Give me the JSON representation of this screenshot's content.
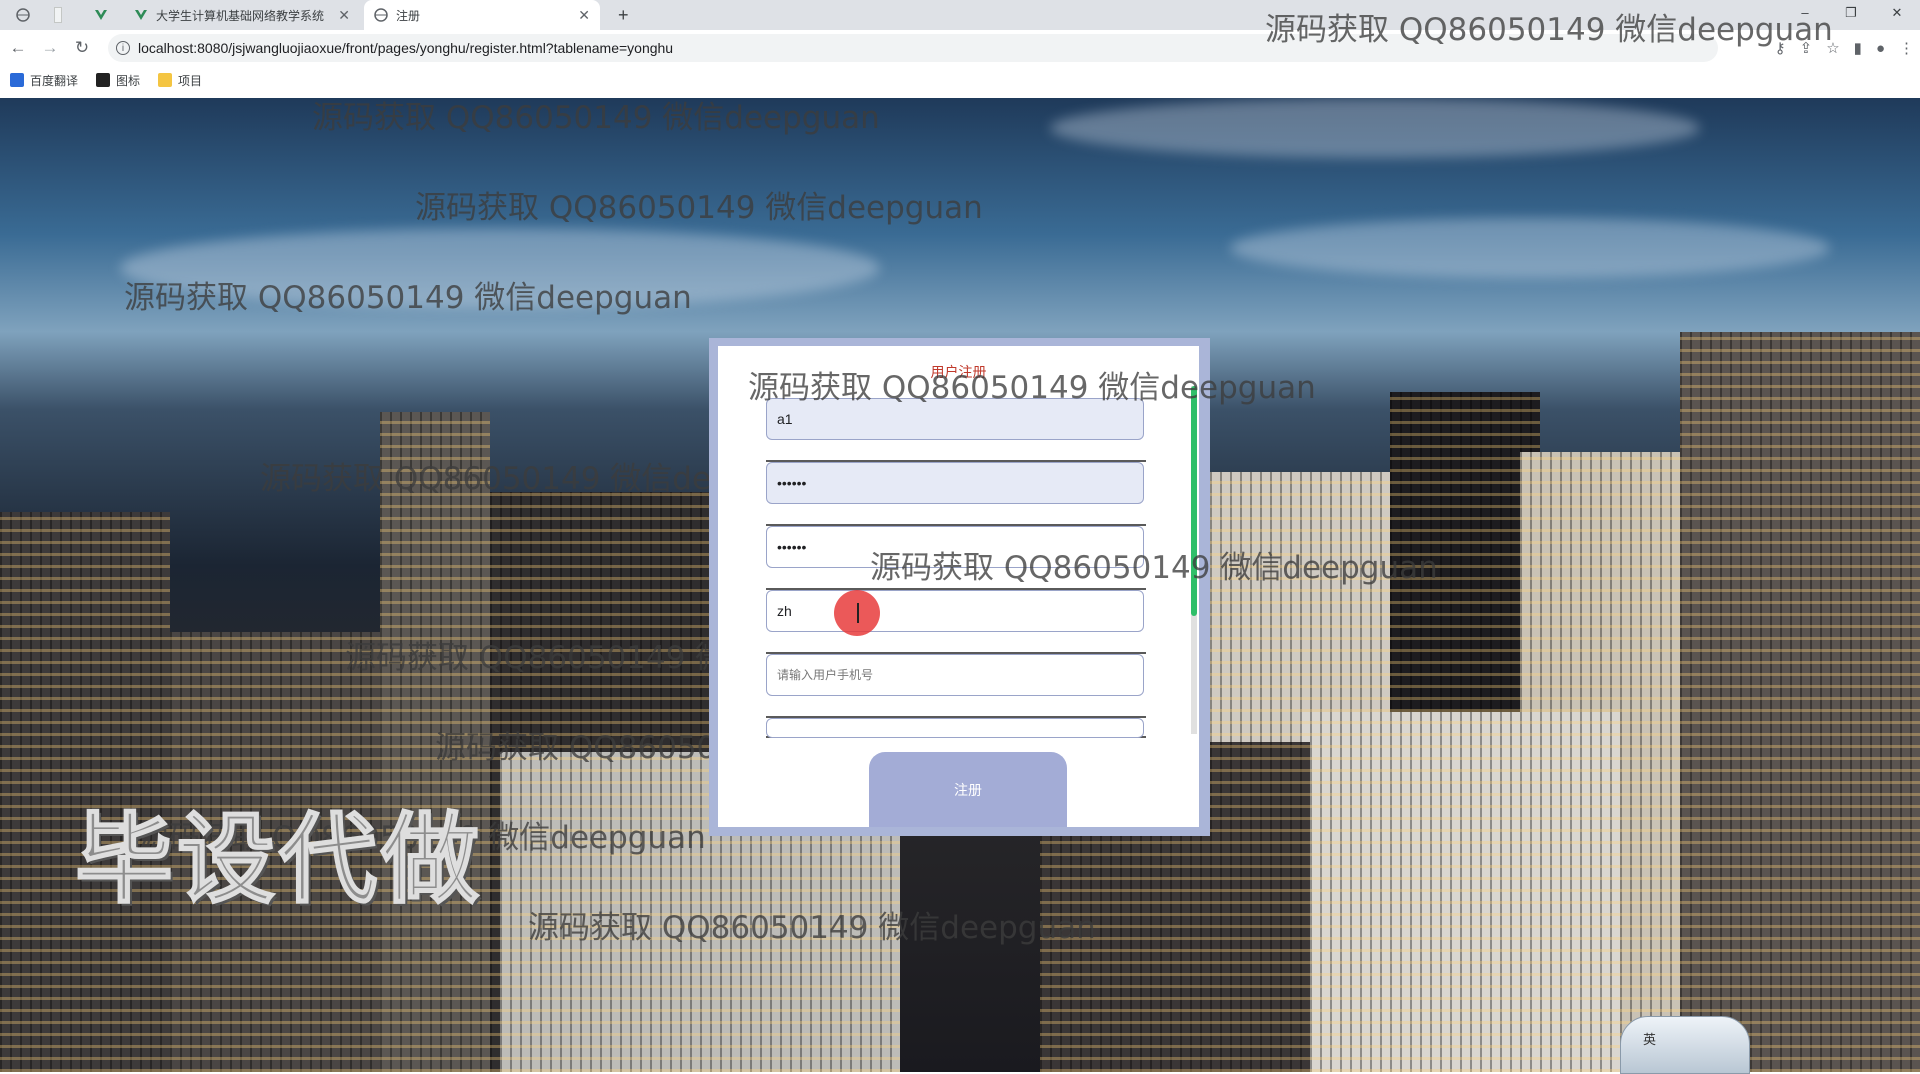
{
  "browser": {
    "tabs": [
      {
        "label": ""
      },
      {
        "label": ""
      },
      {
        "label": ""
      },
      {
        "label": "大学生计算机基础网络教学系统"
      },
      {
        "label": "注册"
      }
    ],
    "new_tab_glyph": "+",
    "url": "localhost:8080/jsjwangluojiaoxue/front/pages/yonghu/register.html?tablename=yonghu",
    "bookmarks": [
      "百度翻译",
      "图标",
      "项目"
    ],
    "window_controls": [
      "–",
      "❐",
      "✕"
    ]
  },
  "watermark_text": "源码获取 QQ86050149 微信deepguan",
  "overlay_text": "毕设代做",
  "register": {
    "title": "用户注册",
    "fields": [
      {
        "value": "a1",
        "placeholder": ""
      },
      {
        "value": "••••••",
        "placeholder": ""
      },
      {
        "value": "••••••",
        "placeholder": ""
      },
      {
        "value": "zh",
        "placeholder": ""
      },
      {
        "value": "",
        "placeholder": "请输入用户手机号"
      }
    ],
    "submit_label": "注册"
  },
  "ime": {
    "label": "英"
  },
  "colors": {
    "panel_border": "#aab5d8",
    "button": "#a3acd6",
    "scroll_thumb": "#2fbf6a",
    "title": "#c0392b"
  }
}
